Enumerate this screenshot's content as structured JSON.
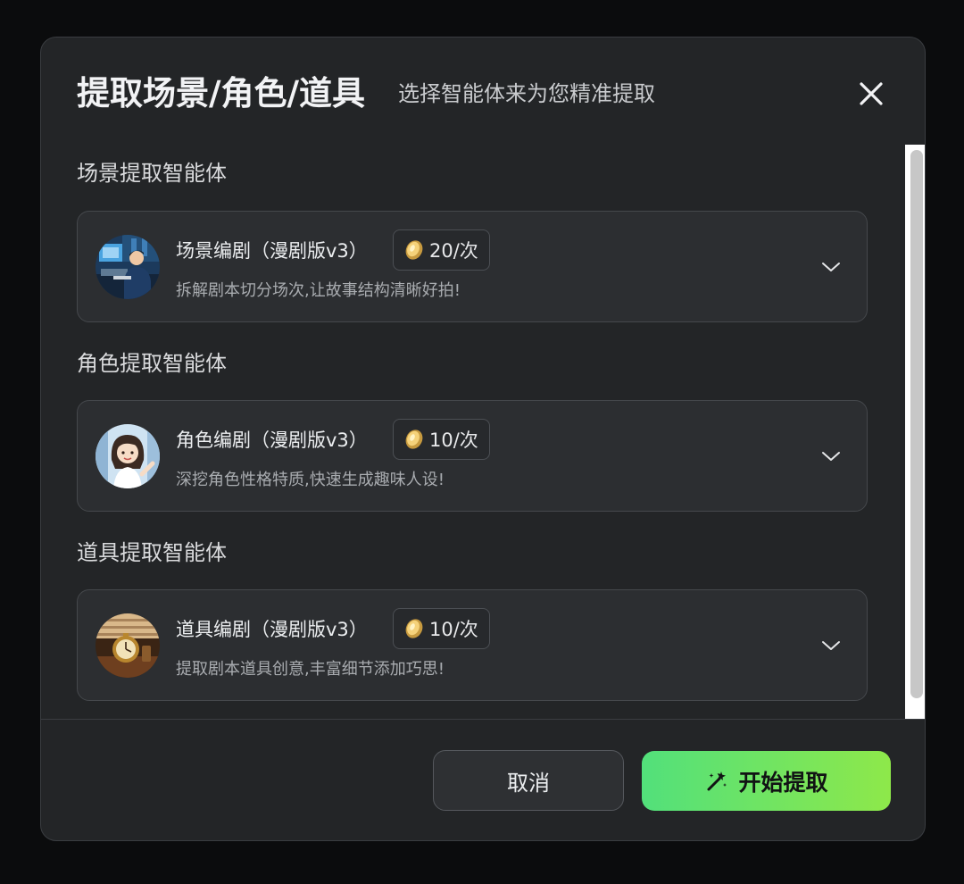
{
  "dialog": {
    "title": "提取场景/角色/道具",
    "subtitle": "选择智能体来为您精准提取"
  },
  "sections": [
    {
      "title": "场景提取智能体",
      "agent": {
        "name": "场景编剧（漫剧版v3）",
        "price": "20/次",
        "description": "拆解剧本切分场次,让故事结构清晰好拍!",
        "avatar_icon": "scene-writer-avatar"
      }
    },
    {
      "title": "角色提取智能体",
      "agent": {
        "name": "角色编剧（漫剧版v3）",
        "price": "10/次",
        "description": "深挖角色性格特质,快速生成趣味人设!",
        "avatar_icon": "character-writer-avatar"
      }
    },
    {
      "title": "道具提取智能体",
      "agent": {
        "name": "道具编剧（漫剧版v3）",
        "price": "10/次",
        "description": "提取剧本道具创意,丰富细节添加巧思!",
        "avatar_icon": "prop-writer-avatar"
      }
    }
  ],
  "footer": {
    "cancel_label": "取消",
    "start_label": "开始提取"
  },
  "colors": {
    "background": "#0b0c0d",
    "modal": "#232527",
    "card": "#2c2e31",
    "accent_start": "#52e07b",
    "accent_end": "#8ee84a"
  }
}
